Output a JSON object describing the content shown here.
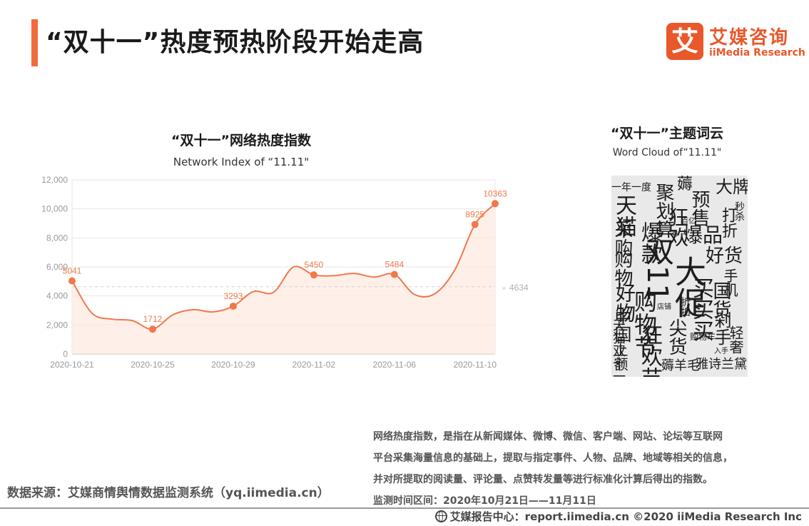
{
  "header": {
    "title": "“双十一”热度预热阶段开始走高"
  },
  "logo": {
    "mark": "艾",
    "cn": "艾媒咨询",
    "en": "iiMedia Research"
  },
  "chart_data": {
    "type": "line",
    "title": "“双十一”网络热度指数",
    "subtitle": "Network Index of “11.11\"",
    "x": [
      "2020-10-21",
      "2020-10-22",
      "2020-10-23",
      "2020-10-24",
      "2020-10-25",
      "2020-10-26",
      "2020-10-27",
      "2020-10-28",
      "2020-10-29",
      "2020-10-30",
      "2020-10-31",
      "2020-11-01",
      "2020-11-02",
      "2020-11-03",
      "2020-11-04",
      "2020-11-05",
      "2020-11-06",
      "2020-11-07",
      "2020-11-08",
      "2020-11-09",
      "2020-11-10",
      "2020-11-11"
    ],
    "series": [
      {
        "values": [
          5041,
          2800,
          2400,
          2300,
          1712,
          2700,
          3050,
          2900,
          3293,
          4300,
          4250,
          6000,
          5450,
          5400,
          5550,
          5300,
          5484,
          4100,
          4150,
          5800,
          8925,
          10363
        ]
      }
    ],
    "labeled_points": [
      {
        "x": "2020-10-21",
        "value": 5041
      },
      {
        "x": "2020-10-25",
        "value": 1712
      },
      {
        "x": "2020-10-29",
        "value": 3293
      },
      {
        "x": "2020-11-02",
        "value": 5450
      },
      {
        "x": "2020-11-06",
        "value": 5484
      },
      {
        "x": "2020-11-10",
        "value": 8925
      },
      {
        "x": "2020-11-11",
        "value": 10363
      }
    ],
    "average": {
      "value": 4634,
      "label": "4634"
    },
    "x_ticks": [
      "2020-10-21",
      "2020-10-25",
      "2020-10-29",
      "2020-11-02",
      "2020-11-06",
      "2020-11-10"
    ],
    "y_ticks": [
      0,
      2000,
      4000,
      6000,
      8000,
      10000,
      12000
    ],
    "y_tick_labels": [
      "0",
      "2,000",
      "4,000",
      "6,000",
      "8,000",
      "10,000",
      "12,000"
    ],
    "ylim": [
      0,
      12000
    ],
    "grid": true,
    "colors": {
      "line": "#f0784a",
      "fill": "#fde9df",
      "average": "#d0d0d0"
    }
  },
  "wordcloud": {
    "title": "“双十一”主题词云",
    "subtitle": "Word Cloud of“11.11\"",
    "words": [
      {
        "text": "一年一度",
        "l": 0,
        "t": 10,
        "s": 14,
        "v": false
      },
      {
        "text": "薅",
        "l": 92,
        "t": 2,
        "s": 22,
        "v": false
      },
      {
        "text": "大牌",
        "l": 146,
        "t": 4,
        "s": 24,
        "v": false
      },
      {
        "text": "天猫",
        "l": 2,
        "t": 26,
        "s": 30,
        "v": true
      },
      {
        "text": "聚划算",
        "l": 60,
        "t": 10,
        "s": 26,
        "v": true
      },
      {
        "text": "预售",
        "l": 110,
        "t": 20,
        "s": 26,
        "v": true
      },
      {
        "text": "秒杀",
        "l": 172,
        "t": 36,
        "s": 14,
        "v": true
      },
      {
        "text": "狂欢",
        "l": 78,
        "t": 44,
        "s": 28,
        "v": true
      },
      {
        "text": "打折",
        "l": 152,
        "t": 44,
        "s": 22,
        "v": true
      },
      {
        "text": "采购",
        "l": 2,
        "t": 62,
        "s": 26,
        "v": true
      },
      {
        "text": "爆款",
        "l": 38,
        "t": 64,
        "s": 30,
        "v": true
      },
      {
        "text": "爆品",
        "l": 100,
        "t": 70,
        "s": 28,
        "v": false
      },
      {
        "text": "百亿",
        "l": 98,
        "t": 60,
        "s": 10,
        "v": false
      },
      {
        "text": "券",
        "l": 84,
        "t": 78,
        "s": 10,
        "v": false
      },
      {
        "text": "好货",
        "l": 132,
        "t": 100,
        "s": 26,
        "v": false
      },
      {
        "text": "手机",
        "l": 156,
        "t": 130,
        "s": 20,
        "v": true
      },
      {
        "text": "购物",
        "l": 2,
        "t": 104,
        "s": 26,
        "v": true
      },
      {
        "text": "双11",
        "l": 44,
        "t": 86,
        "s": 40,
        "v": true
      },
      {
        "text": "大促",
        "l": 84,
        "t": 112,
        "s": 44,
        "v": true
      },
      {
        "text": "好物",
        "l": 4,
        "t": 150,
        "s": 28,
        "v": true
      },
      {
        "text": "中国",
        "l": 2,
        "t": 186,
        "s": 24,
        "v": true
      },
      {
        "text": "购物节",
        "l": 30,
        "t": 160,
        "s": 32,
        "v": true
      },
      {
        "text": "买买买",
        "l": 110,
        "t": 142,
        "s": 30,
        "v": true
      },
      {
        "text": "国货",
        "l": 140,
        "t": 148,
        "s": 26,
        "v": true
      },
      {
        "text": "剁手",
        "l": 142,
        "t": 190,
        "s": 24,
        "v": true
      },
      {
        "text": "狂欢节",
        "l": 38,
        "t": 208,
        "s": 30,
        "v": true
      },
      {
        "text": "尖货",
        "l": 78,
        "t": 200,
        "s": 26,
        "v": true
      },
      {
        "text": "折扣",
        "l": 96,
        "t": 170,
        "s": 14,
        "v": true
      },
      {
        "text": "天猫双十一",
        "l": 0,
        "t": 200,
        "s": 18,
        "v": true
      },
      {
        "text": "上额",
        "l": 2,
        "t": 234,
        "s": 20,
        "v": true
      },
      {
        "text": "轻奢",
        "l": 164,
        "t": 210,
        "s": 20,
        "v": true
      },
      {
        "text": "购物车",
        "l": 110,
        "t": 220,
        "s": 12,
        "v": false
      },
      {
        "text": "薅羊毛",
        "l": 70,
        "t": 258,
        "s": 18,
        "v": false
      },
      {
        "text": "雅诗兰黛",
        "l": 118,
        "t": 256,
        "s": 18,
        "v": false
      },
      {
        "text": "入手",
        "l": 144,
        "t": 242,
        "s": 10,
        "v": false
      },
      {
        "text": "店铺",
        "l": 64,
        "t": 180,
        "s": 10,
        "v": false
      }
    ]
  },
  "note": {
    "lines": [
      "网络热度指数，是指在从新闻媒体、微博、微信、客户端、网站、论坛等互联网",
      "平台采集海量信息的基础上，提取与指定事件、人物、品牌、地域等相关的信息，",
      "并对所提取的阅读量、评论量、点赞转发量等进行标准化计算后得出的指数。",
      "监测时间区间：2020年10月21日——11月11日"
    ]
  },
  "source": {
    "text": "数据来源：艾媒商情舆情数据监测系统（yq.iimedia.cn）"
  },
  "footer": {
    "text": "艾媒报告中心：report.iimedia.cn   ©2020  iiMedia Research  Inc"
  }
}
